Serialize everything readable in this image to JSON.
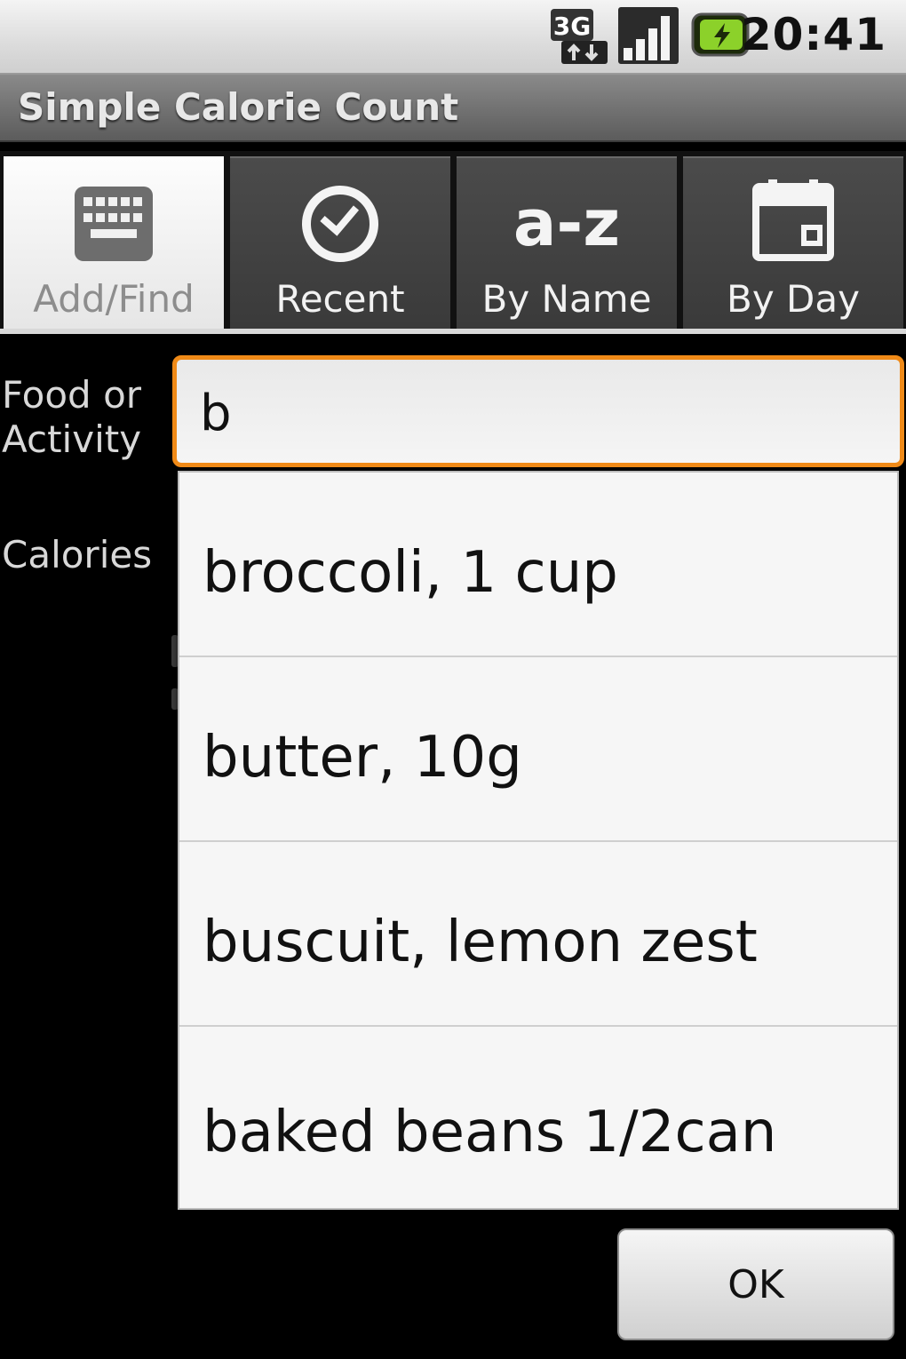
{
  "status_bar": {
    "network_type": "3G",
    "time": "20:41",
    "icons": [
      "3g-data-icon",
      "signal-strength-icon",
      "battery-charging-icon"
    ]
  },
  "app": {
    "title": "Simple Calorie Count"
  },
  "tabs": [
    {
      "label": "Add/Find",
      "icon": "keyboard-icon",
      "selected": true
    },
    {
      "label": "Recent",
      "icon": "clock-icon",
      "selected": false
    },
    {
      "label": "By Name",
      "icon": "a-z-icon",
      "selected": false
    },
    {
      "label": "By Day",
      "icon": "calendar-icon",
      "selected": false
    }
  ],
  "form": {
    "food_label": "Food or Activity",
    "food_value": "b",
    "calories_label": "Calories"
  },
  "autocomplete": {
    "items": [
      "broccoli, 1 cup",
      "butter, 10g",
      "buscuit, lemon zest",
      "baked beans 1/2can"
    ]
  },
  "actions": {
    "ok_label": "OK"
  },
  "colors": {
    "focus_accent": "#f08a17",
    "background": "#000000"
  }
}
